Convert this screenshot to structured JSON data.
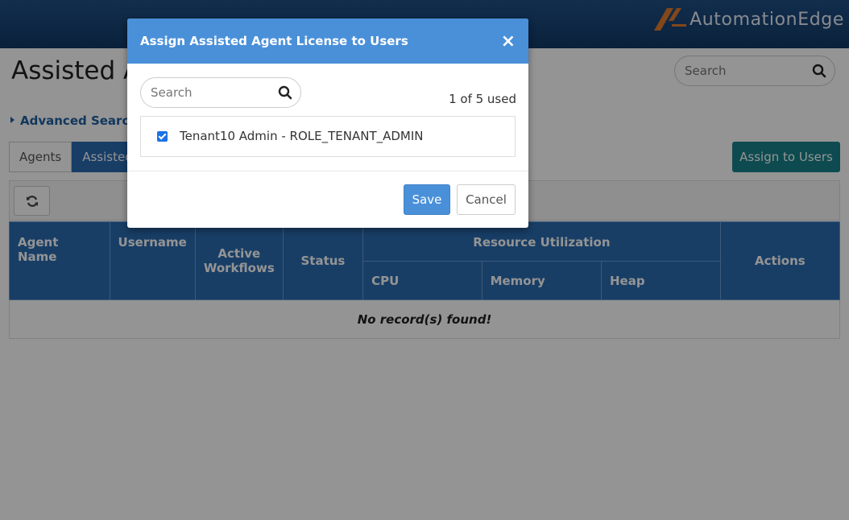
{
  "brand": {
    "name": "AutomationEdge",
    "logo_color": "#e07a2e"
  },
  "page": {
    "title": "Assisted A",
    "search_placeholder": "Search",
    "advanced_search_label": "Advanced Search",
    "tabs": [
      {
        "label": "Agents",
        "active": false
      },
      {
        "label": "Assisted",
        "active": true
      }
    ],
    "assign_button_label": "Assign to Users",
    "table": {
      "headers": {
        "agent_name": "Agent Name",
        "username": "Username",
        "active_workflows": "Active Workflows",
        "status": "Status",
        "resource_utilization": "Resource Utilization",
        "cpu": "CPU",
        "memory": "Memory",
        "heap": "Heap",
        "actions": "Actions"
      },
      "empty_message": "No record(s) found!"
    }
  },
  "modal": {
    "title": "Assign Assisted Agent License to Users",
    "close_glyph": "×",
    "search_placeholder": "Search",
    "usage_text": "1 of 5 used",
    "users": [
      {
        "label": "Tenant10 Admin - ROLE_TENANT_ADMIN",
        "checked": true
      }
    ],
    "save_label": "Save",
    "cancel_label": "Cancel"
  },
  "colors": {
    "header_bar": "#123a66",
    "primary": "#4a90d9",
    "table_header": "#2a6bb0",
    "teal_button": "#17828a"
  }
}
